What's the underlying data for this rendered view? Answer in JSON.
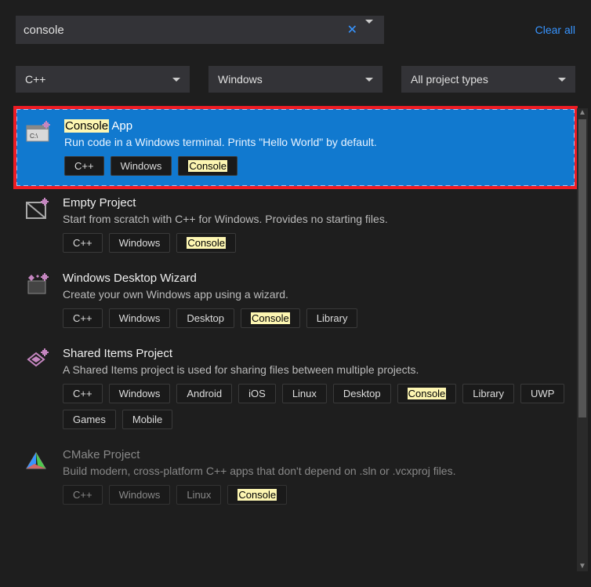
{
  "search": {
    "value": "console"
  },
  "clear_all": "Clear all",
  "filters": {
    "language": "C++",
    "platform": "Windows",
    "project_type": "All project types"
  },
  "templates": [
    {
      "title_pre": "",
      "title_hl": "Console",
      "title_post": " App",
      "desc": "Run code in a Windows terminal. Prints \"Hello World\" by default.",
      "tags": [
        "C++",
        "Windows",
        "Console"
      ],
      "hl_tags": [
        2
      ],
      "selected": true
    },
    {
      "title_pre": "Empty Project",
      "title_hl": "",
      "title_post": "",
      "desc": "Start from scratch with C++ for Windows. Provides no starting files.",
      "tags": [
        "C++",
        "Windows",
        "Console"
      ],
      "hl_tags": [
        2
      ]
    },
    {
      "title_pre": "Windows Desktop Wizard",
      "title_hl": "",
      "title_post": "",
      "desc": "Create your own Windows app using a wizard.",
      "tags": [
        "C++",
        "Windows",
        "Desktop",
        "Console",
        "Library"
      ],
      "hl_tags": [
        3
      ]
    },
    {
      "title_pre": "Shared Items Project",
      "title_hl": "",
      "title_post": "",
      "desc": "A Shared Items project is used for sharing files between multiple projects.",
      "tags": [
        "C++",
        "Windows",
        "Android",
        "iOS",
        "Linux",
        "Desktop",
        "Console",
        "Library",
        "UWP",
        "Games",
        "Mobile"
      ],
      "hl_tags": [
        6
      ]
    },
    {
      "title_pre": "CMake Project",
      "title_hl": "",
      "title_post": "",
      "desc": "Build modern, cross-platform C++ apps that don't depend on .sln or .vcxproj files.",
      "tags": [
        "C++",
        "Windows",
        "Linux",
        "Console"
      ],
      "hl_tags": [
        3
      ],
      "dim": true
    }
  ]
}
